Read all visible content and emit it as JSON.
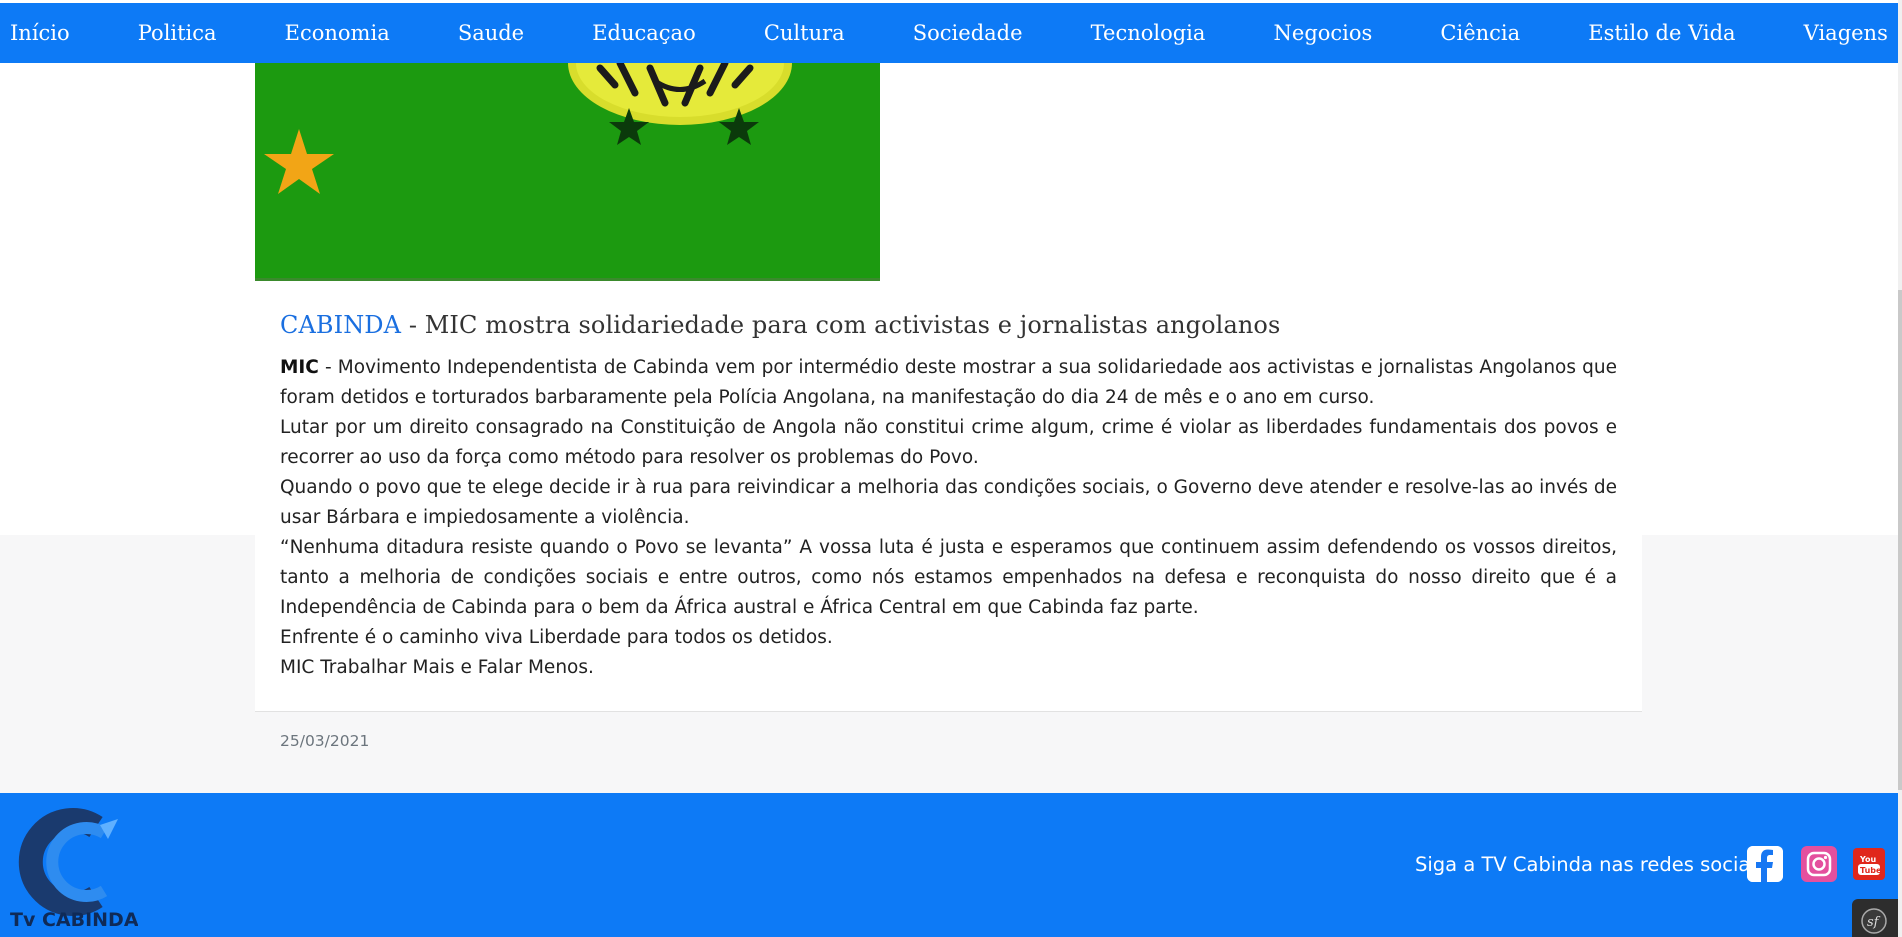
{
  "nav": {
    "items": [
      "Início",
      "Politica",
      "Economia",
      "Saude",
      "Educaçao",
      "Cultura",
      "Sociedade",
      "Tecnologia",
      "Negocios",
      "Ciência",
      "Estilo de Vida",
      "Viagens"
    ]
  },
  "article": {
    "kicker": "CABINDA",
    "title_rest": " - MIC mostra solidariedade para com activistas e jornalistas angolanos",
    "lead_bold": "MIC",
    "paragraphs": [
      " - Movimento Independentista de Cabinda vem por intermédio deste mostrar a sua solidariedade aos activistas e jornalistas Angolanos que foram detidos e torturados barbaramente pela Polícia Angolana, na manifestação do dia 24 de mês e o ano em curso.",
      "Lutar por um direito consagrado na Constituição de Angola não constitui crime algum, crime é violar as liberdades fundamentais dos povos e recorrer ao uso da força como método para resolver os problemas do Povo.",
      "Quando o povo que te elege decide ir à rua para reivindicar a melhoria das condições sociais, o Governo deve atender e resolve-las ao invés de usar Bárbara e impiedosamente a violência.",
      "“Nenhuma ditadura resiste quando o Povo se levanta” A vossa luta é justa e esperamos que continuem assim defendendo os vossos direitos, tanto a melhoria de condições sociais e entre outros, como nós estamos empenhados na defesa e reconquista do nosso direito que é a Independência de Cabinda para o bem da África austral e África Central em que Cabinda faz parte.",
      "Enfrente é o caminho viva Liberdade para todos os detidos.",
      "MIC Trabalhar Mais e Falar Menos."
    ],
    "date": "25/03/2021"
  },
  "footer": {
    "logo_text": "Tv CABINDA",
    "social_text": "Siga a TV Cabinda nas redes sociais",
    "icons": [
      "facebook-icon",
      "instagram-icon",
      "youtube-icon"
    ]
  },
  "colors": {
    "brand_blue": "#0d7af6",
    "flag_green": "#1c9a10",
    "kicker_blue": "#1a6fe0"
  }
}
